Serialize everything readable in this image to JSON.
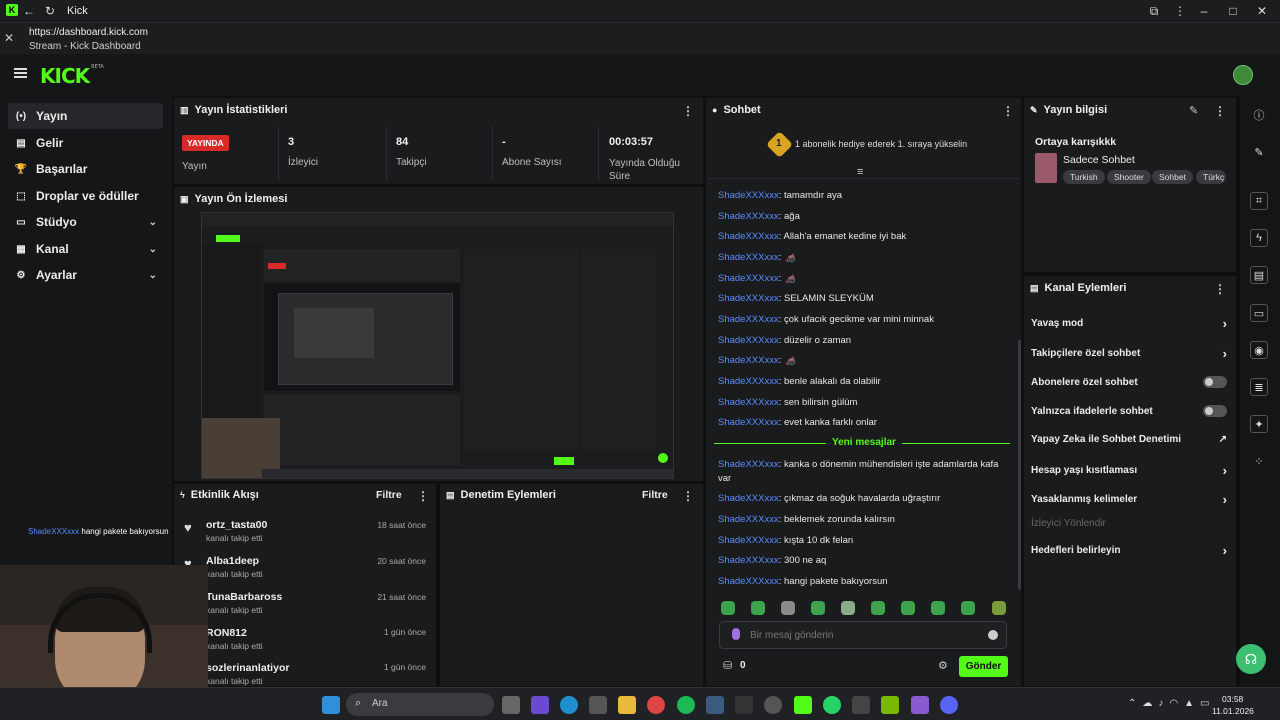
{
  "browser": {
    "tab_title": "Kick",
    "url": "https://dashboard.kick.com",
    "page_title": "Stream - Kick Dashboard"
  },
  "app": {
    "logo": "KICK",
    "logo_sup": "BETA"
  },
  "sidebar": {
    "items": [
      {
        "label": "Yayın",
        "icon": "broadcast-icon",
        "expandable": false
      },
      {
        "label": "Gelir",
        "icon": "revenue-icon",
        "expandable": false
      },
      {
        "label": "Başarılar",
        "icon": "trophy-icon",
        "expandable": false
      },
      {
        "label": "Droplar ve ödüller",
        "icon": "gift-icon",
        "expandable": false
      },
      {
        "label": "Stüdyo",
        "icon": "studio-icon",
        "expandable": true
      },
      {
        "label": "Kanal",
        "icon": "channel-icon",
        "expandable": true
      },
      {
        "label": "Ayarlar",
        "icon": "gear-icon",
        "expandable": true
      }
    ]
  },
  "stats": {
    "title": "Yayın İstatistikleri",
    "live_badge": "YAYINDA",
    "live_label": "Yayın",
    "viewers_value": "3",
    "viewers_label": "İzleyici",
    "followers_value": "84",
    "followers_label": "Takipçi",
    "subs_value": "-",
    "subs_label": "Abone Sayısı",
    "duration_value": "00:03:57",
    "duration_label": "Yayında Olduğu Süre"
  },
  "preview": {
    "title": "Yayın Ön İzlemesi"
  },
  "overlay": {
    "chat_user": "ShadeXXXxxx",
    "chat_text": "hangi pakete bakıyorsun"
  },
  "activity": {
    "title": "Etkinlik Akışı",
    "filter": "Filtre",
    "events": [
      {
        "name": "ortz_tasta00",
        "sub": "kanalı takip etti",
        "time": "18 saat önce"
      },
      {
        "name": "Alba1deep",
        "sub": "kanalı takip etti",
        "time": "20 saat önce"
      },
      {
        "name": "TunaBarbaross",
        "sub": "kanalı takip etti",
        "time": "21 saat önce"
      },
      {
        "name": "RON812",
        "sub": "kanalı takip etti",
        "time": "1 gün önce"
      },
      {
        "name": "sozlerinanlatiyor",
        "sub": "kanalı takip etti",
        "time": "1 gün önce"
      }
    ]
  },
  "moderation": {
    "title": "Denetim Eylemleri",
    "filter": "Filtre"
  },
  "chat": {
    "title": "Sohbet",
    "banner": "1 abonelik hediye ederek 1. sıraya yükselin",
    "banner_rank": "1",
    "new_messages": "Yeni mesajlar",
    "messages_before": [
      {
        "user": "ShadeXXXxxx",
        "text": ": tamamdır aya"
      },
      {
        "user": "ShadeXXXxxx",
        "text": ": ağa"
      },
      {
        "user": "ShadeXXXxxx",
        "text": ": Allah'a emanet kedine iyi bak"
      },
      {
        "user": "ShadeXXXxxx",
        "text": ": 🦽"
      },
      {
        "user": "ShadeXXXxxx",
        "text": ": 🦽"
      },
      {
        "user": "ShadeXXXxxx",
        "text": ": SELAMIN SLEYKÜM"
      },
      {
        "user": "ShadeXXXxxx",
        "text": ": çok ufacık gecikme var mini minnak"
      },
      {
        "user": "ShadeXXXxxx",
        "text": ": düzelir o zaman"
      },
      {
        "user": "ShadeXXXxxx",
        "text": ": 🦽"
      },
      {
        "user": "ShadeXXXxxx",
        "text": ": benle alakalı da olabilir"
      },
      {
        "user": "ShadeXXXxxx",
        "text": ": sen bilirsin gülüm"
      },
      {
        "user": "ShadeXXXxxx",
        "text": ": evet kanka farklı onlar"
      }
    ],
    "msg_long_user": "ShadeXXXxxx",
    "msg_long_text": ": kanka o dönemin mühendisleri işte adamlarda kafa",
    "msg_long_cont": "var",
    "messages_after": [
      {
        "user": "ShadeXXXxxx",
        "text": ": çıkmaz da soğuk havalarda uğraştırır"
      },
      {
        "user": "ShadeXXXxxx",
        "text": ": beklemek zorunda kalırsın"
      },
      {
        "user": "ShadeXXXxxx",
        "text": ": kışta 10 dk felan"
      },
      {
        "user": "ShadeXXXxxx",
        "text": ": 300 ne aq"
      },
      {
        "user": "ShadeXXXxxx",
        "text": ": hangi pakete bakıyorsun"
      }
    ],
    "input_placeholder": "Bir mesaj gönderin",
    "points": "0",
    "send": "Gönder",
    "accent": "#53fc18"
  },
  "stream_info": {
    "title": "Yayın bilgisi",
    "stream_title": "Ortaya karışıkkk",
    "category": "Sadece Sohbet",
    "tags": [
      "Turkish",
      "Shooter",
      "Sohbet",
      "Türkç"
    ]
  },
  "channel_actions": {
    "title": "Kanal Eylemleri",
    "items": [
      {
        "label": "Yavaş mod",
        "control": "chevron"
      },
      {
        "label": "Takipçilere özel sohbet",
        "control": "chevron"
      },
      {
        "label": "Abonelere özel sohbet",
        "control": "toggle"
      },
      {
        "label": "Yalnızca ifadelerle sohbet",
        "control": "toggle"
      },
      {
        "label": "Yapay Zeka ile Sohbet Denetimi",
        "control": "external"
      },
      {
        "label": "Hesap yaşı kısıtlaması",
        "control": "chevron"
      },
      {
        "label": "Yasaklanmış kelimeler",
        "control": "chevron"
      },
      {
        "label": "İzleyici Yönlendir",
        "control": "none"
      },
      {
        "label": "Hedefleri belirleyin",
        "control": "chevron"
      }
    ]
  },
  "taskbar": {
    "search_label": "Ara",
    "time": "03:58",
    "date": "11.01.2026"
  }
}
